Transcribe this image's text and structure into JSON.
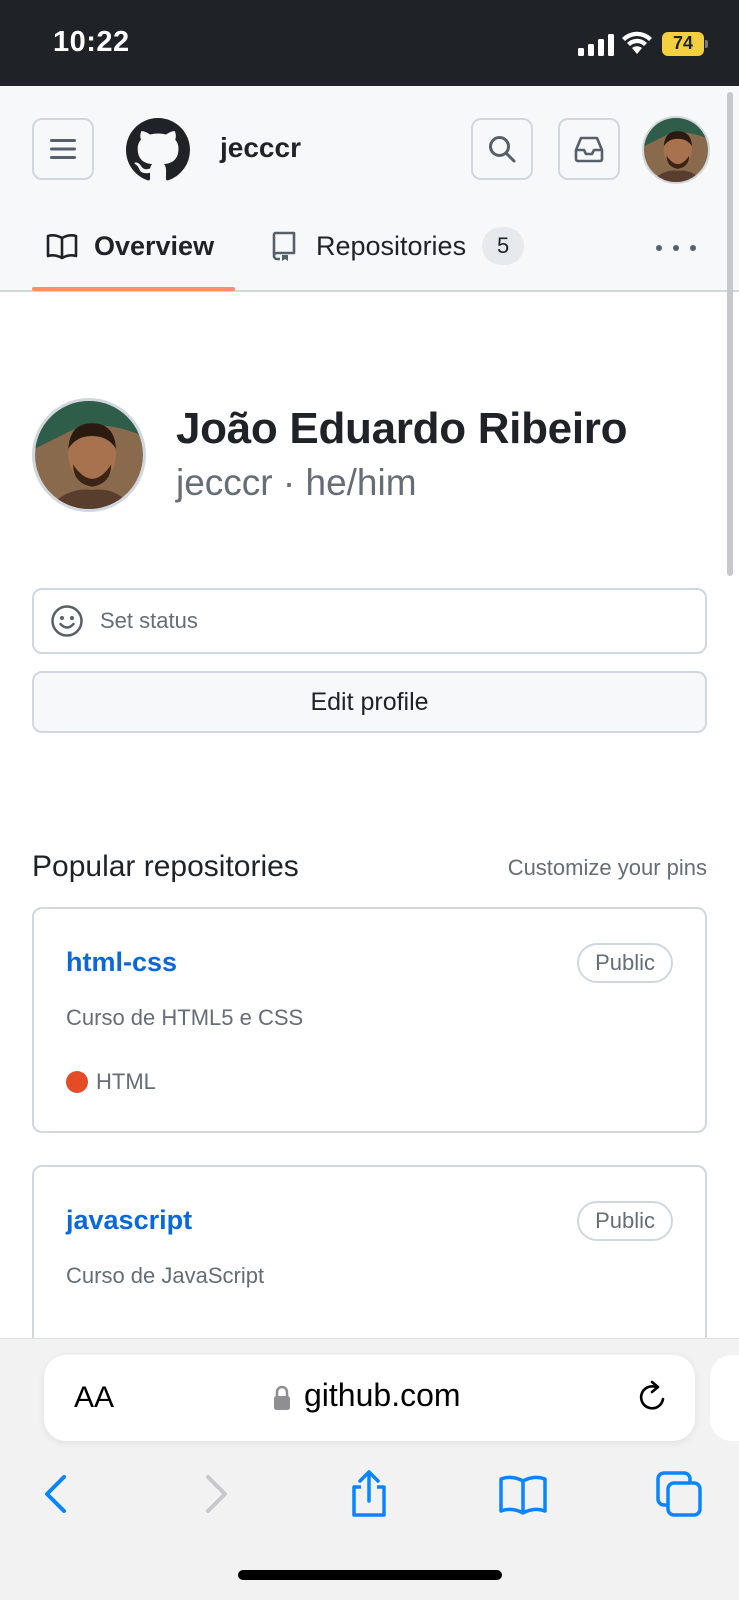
{
  "status_bar": {
    "time": "10:22",
    "battery": "74"
  },
  "header": {
    "username": "jecccr"
  },
  "tabs": {
    "overview": "Overview",
    "repositories": "Repositories",
    "repositories_count": "5"
  },
  "profile": {
    "full_name": "João Eduardo Ribeiro",
    "handle": "jecccr · he/him",
    "set_status": "Set status",
    "edit_profile": "Edit profile"
  },
  "popular": {
    "title": "Popular repositories",
    "customize": "Customize your pins",
    "repos": [
      {
        "name": "html-css",
        "visibility": "Public",
        "description": "Curso de HTML5 e CSS",
        "language": "HTML",
        "language_color": "#e34c26"
      },
      {
        "name": "javascript",
        "visibility": "Public",
        "description": "Curso de JavaScript"
      }
    ]
  },
  "browser": {
    "text_size": "AA",
    "domain": "github.com"
  },
  "colors": {
    "link": "#0969da",
    "tab_underline": "#fd8c73",
    "battery": "#f4d03f"
  }
}
